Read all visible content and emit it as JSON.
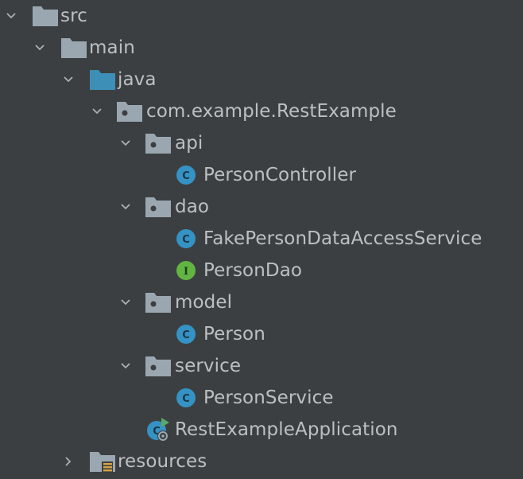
{
  "tree": {
    "src": "src",
    "main": "main",
    "java": "java",
    "package": "com.example.RestExample",
    "api": "api",
    "person_controller": "PersonController",
    "dao": "dao",
    "fake_person_data_access_service": "FakePersonDataAccessService",
    "person_dao": "PersonDao",
    "model": "model",
    "person": "Person",
    "service": "service",
    "person_service": "PersonService",
    "rest_example_application": "RestExampleApplication",
    "resources": "resources"
  },
  "colors": {
    "background": "#3c3f41",
    "text": "#bcc0c3",
    "folder_gray": "#9aa7b0",
    "folder_blue": "#3d8fb7",
    "class_blue": "#3592c4",
    "interface_green": "#62b543",
    "run_green": "#59a869"
  },
  "icons": {
    "expanded": "chevron-down-icon",
    "collapsed": "chevron-right-icon",
    "folder": "folder-icon",
    "source_folder": "source-folder-icon",
    "package": "package-icon",
    "class": "class-icon",
    "interface": "interface-icon",
    "spring_app": "spring-boot-app-icon",
    "resources": "resources-folder-icon"
  }
}
